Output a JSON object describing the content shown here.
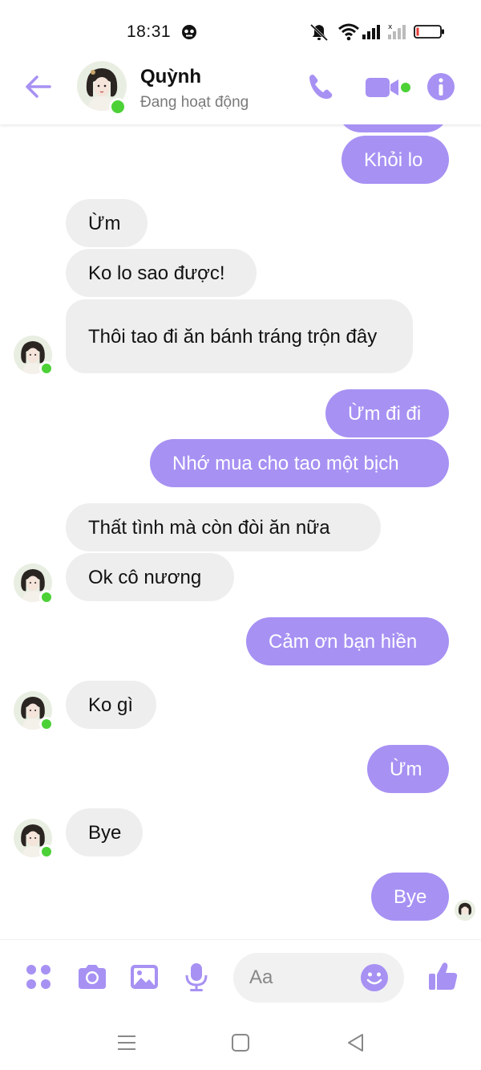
{
  "status_bar": {
    "time": "18:31"
  },
  "header": {
    "contact_name": "Quỳnh",
    "contact_status": "Đang hoạt động",
    "accent_color": "#a791f3",
    "online_color": "#4cd137"
  },
  "messages": [
    {
      "sender": "me",
      "text": "Khỏi lo"
    },
    {
      "sender": "Quỳnh",
      "text": "Ừm"
    },
    {
      "sender": "Quỳnh",
      "text": "Ko lo sao được!"
    },
    {
      "sender": "Quỳnh",
      "text": "Thôi tao đi ăn bánh tráng trộn đây"
    },
    {
      "sender": "me",
      "text": "Ừm đi đi"
    },
    {
      "sender": "me",
      "text": "Nhớ mua cho tao một bịch"
    },
    {
      "sender": "Quỳnh",
      "text": "Thất tình mà còn đòi ăn nữa"
    },
    {
      "sender": "Quỳnh",
      "text": "Ok cô nương"
    },
    {
      "sender": "me",
      "text": "Cảm ơn bạn hiền"
    },
    {
      "sender": "Quỳnh",
      "text": "Ko gì"
    },
    {
      "sender": "me",
      "text": "Ừm"
    },
    {
      "sender": "Quỳnh",
      "text": "Bye"
    },
    {
      "sender": "me",
      "text": "Bye"
    }
  ],
  "composer": {
    "placeholder": "Aa",
    "tools": [
      "apps-icon",
      "camera-icon",
      "image-icon",
      "microphone-icon"
    ],
    "emoji_icon": "smile-icon",
    "send_icon": "thumbs-up-icon"
  },
  "nav": [
    "menu-icon",
    "home-square-icon",
    "back-triangle-icon"
  ]
}
